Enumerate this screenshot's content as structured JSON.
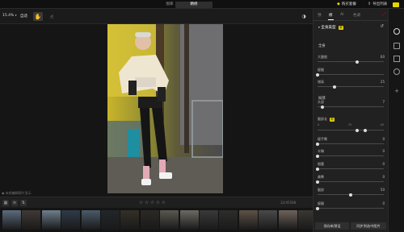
{
  "top": {
    "tabs": [
      "图库",
      "精修"
    ],
    "active_tab": 1,
    "buy_label": "购买套餐",
    "export_label": "导出列表"
  },
  "toolbar": {
    "zoom": "15.4%",
    "fit": "自适"
  },
  "canvas": {
    "status": "未经编辑照片显示"
  },
  "filmstrip": {
    "stars": "☆☆☆☆☆",
    "counter": "32/45588",
    "thumb_colors": [
      "#5b6c7d",
      "#3f3a36",
      "#6d7e8c",
      "#2f3b48",
      "#4b5a6a",
      "#22262a",
      "#343026",
      "#2c2924",
      "#5a5850",
      "#6b6a62",
      "#3a3a3a",
      "#2e2d2c",
      "#5d5246",
      "#4a4a4a",
      "#6e625a",
      "#3b3833",
      "#8a8577",
      "#4a4e52",
      "#b29a7e",
      "#c2b6a4"
    ]
  },
  "panel": {
    "tabs": [
      "预",
      "修",
      "AI",
      "色调"
    ],
    "active_tab": 1,
    "preset_title": "全身美型",
    "preset_badge": "新",
    "section1": "全身",
    "section2": "局部",
    "sliders": [
      {
        "label": "大腿细",
        "value": "60",
        "level": 0.6
      },
      {
        "label": "瘦腿",
        "value": "",
        "level": 0.0
      },
      {
        "label": "增高",
        "value": "25",
        "level": 0.25
      },
      {
        "label": "头部",
        "value": "7",
        "level": 0.07
      },
      {
        "label": "细脖子",
        "value": "",
        "level": 0.0
      },
      {
        "label": "瘦手臂",
        "value": "0",
        "level": 0.0
      },
      {
        "label": "丰胸",
        "value": "0",
        "level": 0.0
      },
      {
        "label": "细腰",
        "value": "0",
        "level": 0.0
      },
      {
        "label": "美臀",
        "value": "0",
        "level": 0.0
      },
      {
        "label": "腿部",
        "value": "50",
        "level": 0.5
      },
      {
        "label": "瘦腿",
        "value": "0",
        "level": 0.0
      }
    ],
    "split_slider": {
      "label": "腿部长",
      "badge": "新",
      "ticks": [
        "0",
        "70",
        "40"
      ],
      "level_left": 0.6,
      "level_right": 0.72
    },
    "btn_save": "保存新预设",
    "btn_sync": "同步到选中图片"
  },
  "colors": {
    "accent": "#e3d400",
    "panel_bg": "#212121",
    "canvas_bg": "#151515"
  }
}
